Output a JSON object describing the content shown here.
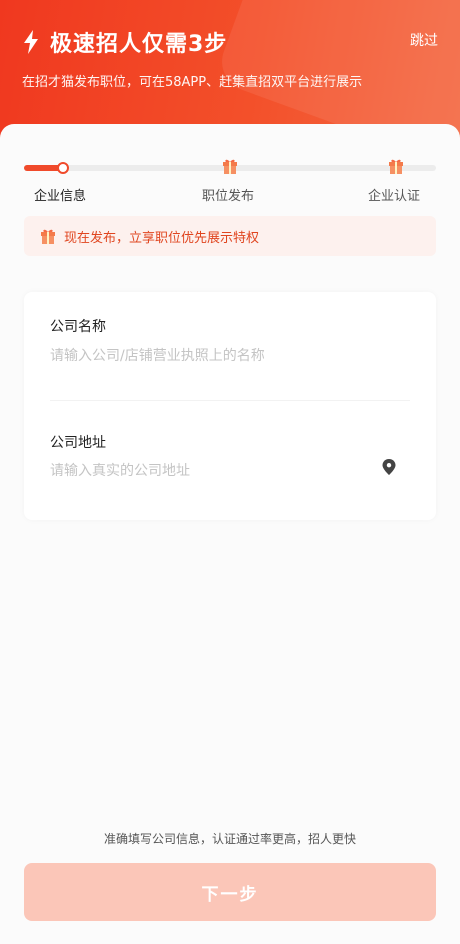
{
  "header": {
    "title": "极速招人仅需3步",
    "skip_label": "跳过",
    "subtitle": "在招才猫发布职位，可在58APP、赶集直招双平台进行展示",
    "colors": {
      "gradient_start": "#f0381f",
      "gradient_end": "#f46a44"
    }
  },
  "steps": {
    "items": [
      {
        "label": "企业信息",
        "state": "active"
      },
      {
        "label": "职位发布",
        "state": "upcoming",
        "icon": "gift-icon"
      },
      {
        "label": "企业认证",
        "state": "upcoming",
        "icon": "gift-icon"
      }
    ],
    "progress_percent": 10,
    "accent_color": "#f04a2b"
  },
  "notice": {
    "icon": "gift-icon",
    "text": "现在发布，立享职位优先展示特权"
  },
  "form": {
    "company_name": {
      "label": "公司名称",
      "value": "",
      "placeholder": "请输入公司/店铺营业执照上的名称"
    },
    "company_address": {
      "label": "公司地址",
      "value": "",
      "placeholder": "请输入真实的公司地址",
      "icon": "location-pin-icon"
    }
  },
  "footer": {
    "hint": "准确填写公司信息，认证通过率更高，招人更快",
    "next_label": "下一步",
    "next_enabled": false
  }
}
